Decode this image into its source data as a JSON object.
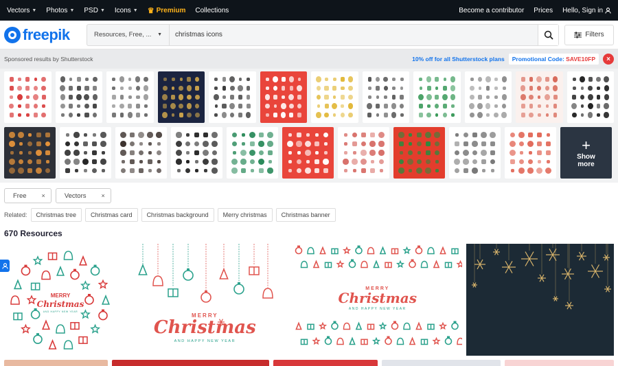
{
  "topnav": {
    "left": [
      {
        "label": "Vectors",
        "caret": true
      },
      {
        "label": "Photos",
        "caret": true
      },
      {
        "label": "PSD",
        "caret": true
      },
      {
        "label": "Icons",
        "caret": true
      },
      {
        "label": "Premium",
        "caret": false
      },
      {
        "label": "Collections",
        "caret": false
      }
    ],
    "right": {
      "contributor": "Become a contributor",
      "prices": "Prices",
      "signin": "Hello, Sign in"
    }
  },
  "header": {
    "logo": "freepik",
    "scope_label": "Resources, Free, ...",
    "search_value": "christmas icons",
    "filters_label": "Filters"
  },
  "sponsor": {
    "label": "Sponsored results by Shutterstock",
    "offer": "10% off for all Shutterstock plans",
    "promo_prefix": "Promotional Code: ",
    "promo_code": "SAVE10FP",
    "show_more": "Show more"
  },
  "chips": [
    {
      "label": "Free"
    },
    {
      "label": "Vectors"
    }
  ],
  "related": {
    "label": "Related:",
    "tags": [
      "Christmas tree",
      "Christmas card",
      "Christmas background",
      "Merry christmas",
      "Christmas banner"
    ]
  },
  "results": {
    "count": "670 Resources"
  },
  "thumb_palettes": {
    "row1": [
      "#fff|#d83a3a",
      "#fff|#444",
      "#fff|#666",
      "#1b2440|#c9a24b",
      "#fff|#333",
      "#e9453b|#fff",
      "#fff|#e2b93b",
      "#fff|#555",
      "#fff|#3a9a5a",
      "#fff|#888",
      "#fbf1ee|#d86a5a",
      "#fff|#222"
    ],
    "row2": [
      "#2d3038|#e7943a",
      "#fff|#222",
      "#fff|#3a302c",
      "#fff|#1b1b1b",
      "#fff|#2a8a5a",
      "#e9453b|#fff",
      "#fff|#d8706a",
      "#e33d2d|#2d8a3f",
      "#fff|#777",
      "#fff|#e26a5a"
    ]
  },
  "result_cards": [
    {
      "bg": "#ffffff",
      "accent": "#2aa18c",
      "secondary": "#d83a3a",
      "headline": "Merry Christmas",
      "subline": "and happy new year"
    },
    {
      "bg": "#ffffff",
      "accent": "#e0544e",
      "secondary": "#2aa18c",
      "headline": "Christmas",
      "subline": "and happy new year",
      "kicker": "Merry"
    },
    {
      "bg": "#ffffff",
      "accent": "#e0544e",
      "secondary": "#2aa18c",
      "headline": "Christmas",
      "subline": "and happy new year",
      "kicker": "Merry"
    },
    {
      "bg": "#1c2a35",
      "accent": "#d7b36b"
    }
  ],
  "bottom_strip": [
    "#e8b9a0",
    "#c72c2c",
    "#d8383a",
    "#e1e4ea",
    "#f8d4d4"
  ],
  "colors": {
    "brand": "#1273eb",
    "premium": "#ffb31a",
    "promo": "#e63a3a"
  }
}
